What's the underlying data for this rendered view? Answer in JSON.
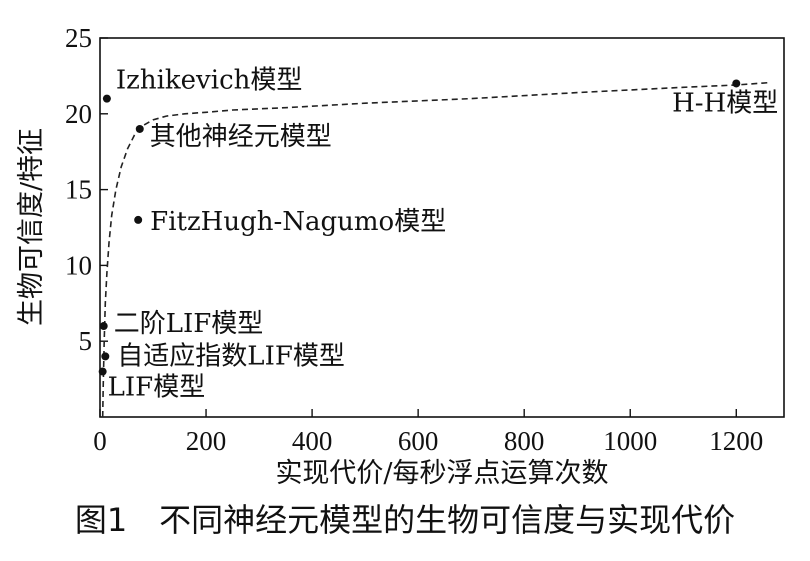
{
  "chart_data": {
    "type": "scatter",
    "xlabel": "实现代价/每秒浮点运算次数",
    "ylabel": "生物可信度/特征",
    "xlim": [
      0,
      1290
    ],
    "ylim": [
      0,
      25
    ],
    "x_ticks": [
      0,
      200,
      400,
      600,
      800,
      1000,
      1200
    ],
    "y_ticks": [
      5,
      10,
      15,
      20,
      25
    ],
    "grid": false,
    "points": [
      {
        "label": "Izhikevich模型",
        "x": 13,
        "y": 21
      },
      {
        "label": "其他神经元模型",
        "x": 75,
        "y": 19
      },
      {
        "label": "FitzHugh-Nagumo模型",
        "x": 72,
        "y": 13
      },
      {
        "label": "二阶LIF模型",
        "x": 7,
        "y": 6
      },
      {
        "label": "自适应指数LIF模型",
        "x": 10,
        "y": 4
      },
      {
        "label": "LIF模型",
        "x": 5,
        "y": 3
      },
      {
        "label": "H-H模型",
        "x": 1200,
        "y": 22
      }
    ],
    "trend_line": {
      "style": "dashed",
      "x": [
        5,
        6,
        8,
        10,
        13,
        17,
        22,
        30,
        40,
        52,
        65,
        80,
        100,
        125,
        160,
        200,
        250,
        350,
        500,
        700,
        900,
        1100,
        1200,
        1260
      ],
      "y": [
        0,
        2,
        5,
        7.5,
        9.5,
        11.5,
        13.3,
        15,
        16.5,
        17.7,
        18.6,
        19.2,
        19.6,
        19.85,
        20,
        20.1,
        20.25,
        20.4,
        20.7,
        21,
        21.4,
        21.75,
        21.9,
        22.05
      ]
    }
  },
  "caption": "图1　不同神经元模型的生物可信度与实现代价"
}
